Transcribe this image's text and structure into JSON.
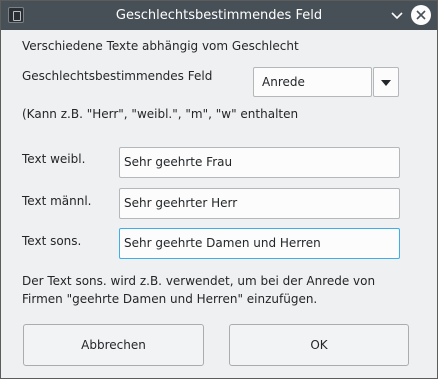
{
  "window": {
    "title": "Geschlechtsbestimmendes Feld",
    "icons": [
      "app-icon",
      "chevron-down-icon",
      "close-icon"
    ]
  },
  "intro": "Verschiedene Texte abhängig vom Geschlecht",
  "field_selector": {
    "label": "Geschlechtsbestimmendes Feld",
    "selected": "Anrede"
  },
  "hint": "(Kann z.B. \"Herr\", \"weibl.\", \"m\", \"w\" enthalten",
  "rows": [
    {
      "label": "Text weibl.",
      "value": "Sehr geehrte Frau"
    },
    {
      "label": "Text männl.",
      "value": "Sehr geehrter Herr"
    },
    {
      "label": "Text sons.",
      "value": "Sehr geehrte Damen und Herren"
    }
  ],
  "note_line1": "Der Text sons. wird z.B. verwendet, um bei der Anrede von",
  "note_line2": "Firmen \"geehrte Damen und Herren\" einzufügen.",
  "buttons": {
    "cancel": "Abbrechen",
    "ok": "OK"
  },
  "colors": {
    "titlebar": "#475057",
    "window_bg": "#eff0f1",
    "focus": "#3daee9"
  }
}
